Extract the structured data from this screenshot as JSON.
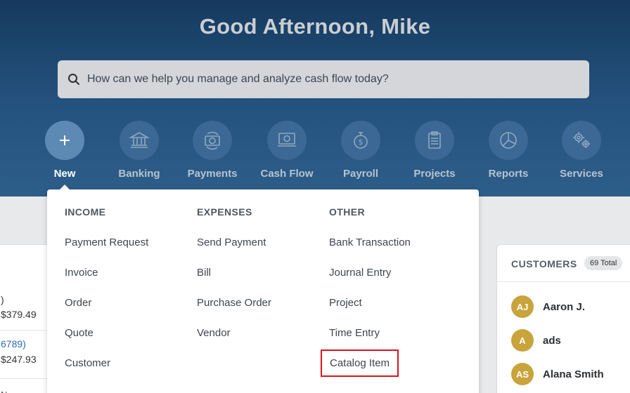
{
  "header": {
    "greeting": "Good Afternoon, Mike",
    "search_placeholder": "How can we help you manage and analyze cash flow today?"
  },
  "nav": {
    "new": "New",
    "banking": "Banking",
    "payments": "Payments",
    "cashflow": "Cash Flow",
    "payroll": "Payroll",
    "projects": "Projects",
    "reports": "Reports",
    "services": "Services"
  },
  "dropdown": {
    "income": {
      "title": "INCOME",
      "items": [
        "Payment Request",
        "Invoice",
        "Order",
        "Quote",
        "Customer"
      ]
    },
    "expenses": {
      "title": "EXPENSES",
      "items": [
        "Send Payment",
        "Bill",
        "Purchase Order",
        "Vendor"
      ]
    },
    "other": {
      "title": "OTHER",
      "items": [
        "Bank Transaction",
        "Journal Entry",
        "Project",
        "Time Entry",
        "Catalog Item"
      ]
    }
  },
  "background": {
    "left_card": {
      "line1": ")",
      "line2": "$379.49",
      "line3": "6789)",
      "line4": "$247.93",
      "line5": "N"
    },
    "customers": {
      "title": "CUSTOMERS",
      "badge": "69 Total",
      "rows": [
        {
          "initials": "AJ",
          "name": "Aaron J."
        },
        {
          "initials": "A",
          "name": "ads"
        },
        {
          "initials": "AS",
          "name": "Alana Smith"
        }
      ]
    }
  },
  "colors": {
    "hero_top": "#163a5e",
    "hero_bottom": "#2d5d89",
    "highlight_border": "#e0101a",
    "avatar": "#c9a33b"
  }
}
